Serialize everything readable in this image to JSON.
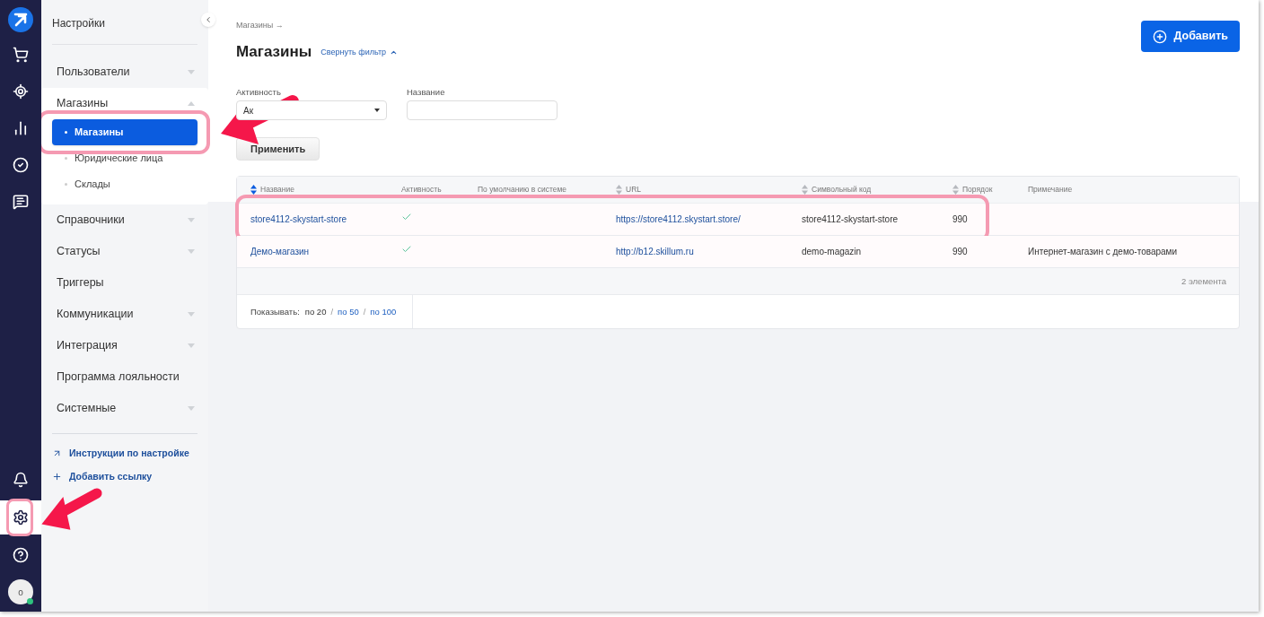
{
  "rail": {
    "top": [
      {
        "kind": "cart"
      },
      {
        "kind": "target"
      },
      {
        "kind": "chart"
      },
      {
        "kind": "check"
      },
      {
        "kind": "chat"
      }
    ],
    "bottom": [
      {
        "kind": "bell",
        "selected": false
      },
      {
        "kind": "settings",
        "selected": true,
        "annotated": true
      },
      {
        "kind": "help",
        "selected": false
      }
    ],
    "avatar": {
      "initial": "о",
      "online": true
    }
  },
  "sidebar": {
    "title": "Настройки",
    "items": [
      {
        "label": "Пользователи",
        "expandable": true,
        "expanded": false
      },
      {
        "label": "Магазины",
        "expandable": true,
        "expanded": true,
        "children": [
          {
            "label": "Магазины",
            "selected": true,
            "annotated": true
          },
          {
            "label": "Юридические лица",
            "selected": false
          },
          {
            "label": "Склады",
            "selected": false
          }
        ]
      },
      {
        "label": "Справочники",
        "expandable": true,
        "expanded": false
      },
      {
        "label": "Статусы",
        "expandable": true,
        "expanded": false
      },
      {
        "label": "Триггеры",
        "expandable": false
      },
      {
        "label": "Коммуникации",
        "expandable": true,
        "expanded": false
      },
      {
        "label": "Интеграция",
        "expandable": true,
        "expanded": false
      },
      {
        "label": "Программа лояльности",
        "expandable": false
      },
      {
        "label": "Системные",
        "expandable": true,
        "expanded": false
      }
    ],
    "links": [
      {
        "kind": "external",
        "label": "Инструкции по настройке"
      },
      {
        "kind": "add",
        "label": "Добавить ссылку"
      }
    ]
  },
  "breadcrumb": "Магазины →",
  "title": "Магазины",
  "filter_toggle": "Свернуть фильтр",
  "add_button": "Добавить",
  "filters": [
    {
      "kind": "select",
      "label": "Активность",
      "value": "Ак"
    },
    {
      "kind": "input",
      "label": "Название"
    }
  ],
  "apply_button": "Применить",
  "table": {
    "columns": [
      {
        "label": "Название",
        "sortable": true,
        "sorted": true
      },
      {
        "label": "Активность",
        "sortable": false
      },
      {
        "label": "По умолчанию в системе",
        "sortable": false
      },
      {
        "label": "URL",
        "sortable": true,
        "sorted": false
      },
      {
        "label": "Символьный код",
        "sortable": true,
        "sorted": false
      },
      {
        "label": "Порядок",
        "sortable": true,
        "sorted": false
      },
      {
        "label": "Примечание",
        "sortable": false
      }
    ],
    "rows": [
      {
        "name": "store4112-skystart-store",
        "active": true,
        "url": "https://store4112.skystart.store/",
        "code": "store4112-skystart-store",
        "order": "990",
        "annotated": true
      },
      {
        "name": "Демо-магазин",
        "active": true,
        "url": "http://b12.skillum.ru",
        "code": "demo-magazin",
        "order": "990",
        "note": "Интернет-магазин с демо-товарами"
      }
    ],
    "count": "2 элемента",
    "page_size": {
      "label": "Показывать:",
      "separator": "/",
      "options": [
        {
          "label": "по 20",
          "selected": true
        },
        {
          "label": "по 50",
          "selected": false
        },
        {
          "label": "по 100",
          "selected": false
        }
      ]
    }
  }
}
